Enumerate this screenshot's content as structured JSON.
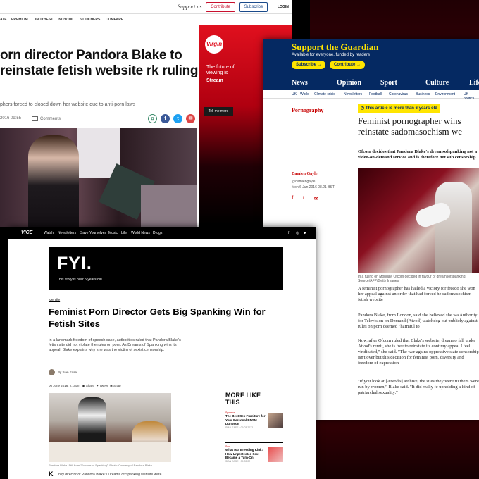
{
  "independent": {
    "support_text": "Support us",
    "contribute": "Contribute",
    "subscribe": "Subscribe",
    "login": "LOGIN",
    "nav": [
      "ATE",
      "PREMIUM",
      "INDYBEST",
      "INDY/100",
      "VOUCHERS",
      "COMPARE"
    ],
    "headline": "orn director Pandora Blake to reinstate fetish website rk ruling",
    "standfirst": "phers forced to closed down her website due to anti-porn laws",
    "meta_date": "2016 09:55",
    "comments": "Comments",
    "ad": {
      "logo": "Virgin",
      "line1": "The future of viewing is",
      "line2": "Stream",
      "button": "Tell me more"
    }
  },
  "guardian": {
    "support_title": "Support the Guardian",
    "available": "Available for everyone, funded by readers",
    "subscribe": "Subscribe",
    "contribute": "Contribute",
    "pillars": [
      "News",
      "Opinion",
      "Sport",
      "Culture",
      "Life"
    ],
    "subnav": [
      "UK",
      "World",
      "Climate crisis",
      "Newsletters",
      "Football",
      "Coronavirus",
      "Business",
      "Environment",
      "UK politics"
    ],
    "section": "Pornography",
    "notice": "This article is more than 6 years old",
    "title": "Feminist pornographer wins reinstate sadomasochism we",
    "standfirst": "Ofcom decides that Pandora Blake's dreamsofspanking not a video-on-demand service and is therefore not sub censorship",
    "author": "Damien Gayle",
    "handle": "@damiengayle",
    "date": "Mon 6 Jun 2016 08.21 BST",
    "caption": "In a ruling on Monday, Ofcom decided in favour of dreamsofspanking. Source/AFP/Getty Images",
    "paragraphs": [
      "A feminist pornographer has hailed a victory for freedo she won her appeal against an order that had forced he sadomasochism fetish website",
      "Pandora Blake, from London, said she believed she wa Authority for Television on Demand (Atvod) watchdog out publicly against rules on porn deemed \"harmful to",
      "Now, after Ofcom ruled that Blake's website, dreamso fall under Atvod's remit, she is free to reinstate its cont my appeal I feel vindicated,\" she said. \"The war agains oppressive state censorship isn't over but this decision for feminist porn, diversity and freedom of expression",
      "\"If you look at [Atvod's] archive, the sites they were ru them were run by women,\" Blake said. \"It did really fe upholding a kind of patriarchal sexuality.\""
    ]
  },
  "vice": {
    "logo": "VICE",
    "nav": [
      "Watch",
      "Newsletters",
      "Save Yourselves",
      "Music",
      "Life",
      "World News",
      "Drugs"
    ],
    "fyi": "FYI.",
    "fyi_sub": "This story is over 5 years old.",
    "tag": "Identity",
    "title": "Feminist Porn Director Gets Big Spanking Win for Fetish Sites",
    "dek": "In a landmark freedom of speech case, authorities ruled that Pandora Blake's fetish site did not violate the rules on porn. As Dreams of Spanking wins its appeal, Blake explains why she was the victim of sexist censorship.",
    "byline": "By Sian Ease",
    "date": "06 June 2016, 2:15pm",
    "share": "Share",
    "tweet": "Tweet",
    "snap": "Snap",
    "photo_caption": "Pandora Blake. Still from \"Dreams of Spanking\". Photo: Courtesy of Pandora Blake",
    "more_like_this": "MORE LIKE THIS",
    "more": [
      {
        "cat": "Sponsor",
        "title": "The Best Sex Furniture for Your Personal BDSM Dungeon",
        "meta": "SIAN EASE · 09.03.2022"
      },
      {
        "cat": "Sex",
        "title": "What Is a Breeding Kink? How Unprotected Sex Became a Turn-On",
        "meta": "SIAN EASE · 09.03.22"
      }
    ],
    "lead": "inky director of Pandora Blake's Dreams of Spanking website were"
  },
  "colors": {
    "independent_red": "#c8102e",
    "guardian_blue": "#052962",
    "guardian_yellow": "#ffe500",
    "guardian_red": "#c70000",
    "vice_black": "#000000",
    "virgin_red": "#e0101e"
  }
}
